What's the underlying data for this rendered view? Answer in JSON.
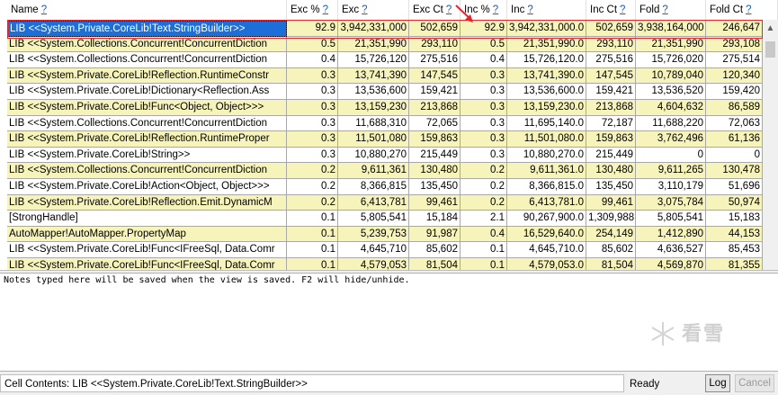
{
  "columns": [
    {
      "label": "Name",
      "help": "?"
    },
    {
      "label": "Exc %",
      "help": "?"
    },
    {
      "label": "Exc",
      "help": "?"
    },
    {
      "label": "Exc Ct",
      "help": "?"
    },
    {
      "label": "Inc %",
      "help": "?"
    },
    {
      "label": "Inc",
      "help": "?"
    },
    {
      "label": "Inc Ct",
      "help": "?"
    },
    {
      "label": "Fold",
      "help": "?"
    },
    {
      "label": "Fold Ct",
      "help": "?"
    }
  ],
  "rows": [
    [
      "LIB <<System.Private.CoreLib!Text.StringBuilder>>",
      "92.9",
      "3,942,331,000",
      "502,659",
      "92.9",
      "3,942,331,000.0",
      "502,659",
      "3,938,164,000",
      "246,647"
    ],
    [
      "LIB <<System.Collections.Concurrent!ConcurrentDiction",
      "0.5",
      "21,351,990",
      "293,110",
      "0.5",
      "21,351,990.0",
      "293,110",
      "21,351,990",
      "293,108"
    ],
    [
      "LIB <<System.Collections.Concurrent!ConcurrentDiction",
      "0.4",
      "15,726,120",
      "275,516",
      "0.4",
      "15,726,120.0",
      "275,516",
      "15,726,020",
      "275,514"
    ],
    [
      "LIB <<System.Private.CoreLib!Reflection.RuntimeConstr",
      "0.3",
      "13,741,390",
      "147,545",
      "0.3",
      "13,741,390.0",
      "147,545",
      "10,789,040",
      "120,340"
    ],
    [
      "LIB <<System.Private.CoreLib!Dictionary<Reflection.Ass",
      "0.3",
      "13,536,600",
      "159,421",
      "0.3",
      "13,536,600.0",
      "159,421",
      "13,536,520",
      "159,420"
    ],
    [
      "LIB <<System.Private.CoreLib!Func<Object, Object>>>",
      "0.3",
      "13,159,230",
      "213,868",
      "0.3",
      "13,159,230.0",
      "213,868",
      "4,604,632",
      "86,589"
    ],
    [
      "LIB <<System.Collections.Concurrent!ConcurrentDiction",
      "0.3",
      "11,688,310",
      "72,065",
      "0.3",
      "11,695,140.0",
      "72,187",
      "11,688,220",
      "72,063"
    ],
    [
      "LIB <<System.Private.CoreLib!Reflection.RuntimeProper",
      "0.3",
      "11,501,080",
      "159,863",
      "0.3",
      "11,501,080.0",
      "159,863",
      "3,762,496",
      "61,136"
    ],
    [
      "LIB <<System.Private.CoreLib!String>>",
      "0.3",
      "10,880,270",
      "215,449",
      "0.3",
      "10,880,270.0",
      "215,449",
      "0",
      "0"
    ],
    [
      "LIB <<System.Collections.Concurrent!ConcurrentDiction",
      "0.2",
      "9,611,361",
      "130,480",
      "0.2",
      "9,611,361.0",
      "130,480",
      "9,611,265",
      "130,478"
    ],
    [
      "LIB <<System.Private.CoreLib!Action<Object, Object>>>",
      "0.2",
      "8,366,815",
      "135,450",
      "0.2",
      "8,366,815.0",
      "135,450",
      "3,110,179",
      "51,696"
    ],
    [
      "LIB <<System.Private.CoreLib!Reflection.Emit.DynamicM",
      "0.2",
      "6,413,781",
      "99,461",
      "0.2",
      "6,413,781.0",
      "99,461",
      "3,075,784",
      "50,974"
    ],
    [
      "[StrongHandle]",
      "0.1",
      "5,805,541",
      "15,184",
      "2.1",
      "90,267,900.0",
      "1,309,988",
      "5,805,541",
      "15,183"
    ],
    [
      "AutoMapper!AutoMapper.PropertyMap",
      "0.1",
      "5,239,753",
      "91,987",
      "0.4",
      "16,529,640.0",
      "254,149",
      "1,412,890",
      "44,153"
    ],
    [
      "LIB <<System.Private.CoreLib!Func<IFreeSql, Data.Comr",
      "0.1",
      "4,645,710",
      "85,602",
      "0.1",
      "4,645,710.0",
      "85,602",
      "4,636,527",
      "85,453"
    ],
    [
      "LIB <<System.Private.CoreLib!Func<IFreeSql, Data.Comr",
      "0.1",
      "4,579,053",
      "81,504",
      "0.1",
      "4,579,053.0",
      "81,504",
      "4,569,870",
      "81,355"
    ]
  ],
  "row_colors": [
    "y",
    "y",
    "w",
    "y",
    "w",
    "y",
    "w",
    "y",
    "w",
    "y",
    "w",
    "y",
    "w",
    "y",
    "w",
    "y"
  ],
  "notes_text": "Notes typed here will be saved when the view is saved. F2 will hide/unhide.",
  "status": {
    "cell_contents": "Cell Contents: LIB <<System.Private.CoreLib!Text.StringBuilder>>",
    "state": "Ready",
    "log_label": "Log",
    "cancel_label": "Cancel"
  },
  "watermark": "看雪",
  "colors": {
    "highlight_box": "#e5232b",
    "selection": "#1c6ed8",
    "row_yellow": "#f7f4bb"
  }
}
